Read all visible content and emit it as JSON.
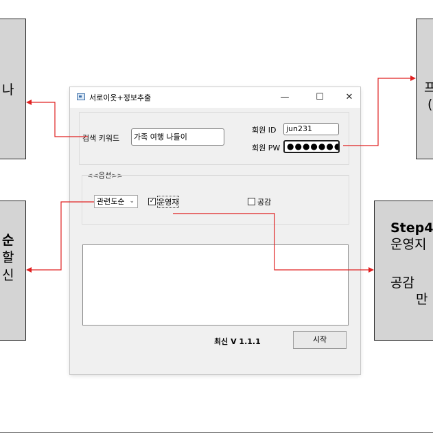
{
  "window": {
    "title": "서로이웃+정보추출",
    "minimize": "—",
    "maximize": "☐",
    "close": "✕"
  },
  "search": {
    "keyword_label": "검색 키워드",
    "keyword_value": "가족 여행 나들이"
  },
  "member": {
    "id_label": "회원 ID",
    "id_value": "jun231",
    "pw_label": "회원 PW",
    "pw_value": "●●●●●●●"
  },
  "options": {
    "group_label": "<<옵션>>",
    "sort_selected": "관련도순",
    "operator_label": "운영자",
    "operator_checked": true,
    "empathy_label": "공감",
    "empathy_checked": false
  },
  "footer": {
    "version_label": "최신 V 1.1.1",
    "start_button": "시작"
  },
  "callouts": {
    "top_left": "나",
    "mid_left_line1": "순",
    "mid_left_line2": "할",
    "mid_left_line3": "신",
    "top_right_line1": "프",
    "top_right_line2": "(",
    "right_line1": "Step4",
    "right_line2": "운영지",
    "right_line3": "공감 ",
    "right_line4": "만"
  },
  "colors": {
    "connector": "#e02020",
    "callout_fill": "#d4d4d4"
  }
}
